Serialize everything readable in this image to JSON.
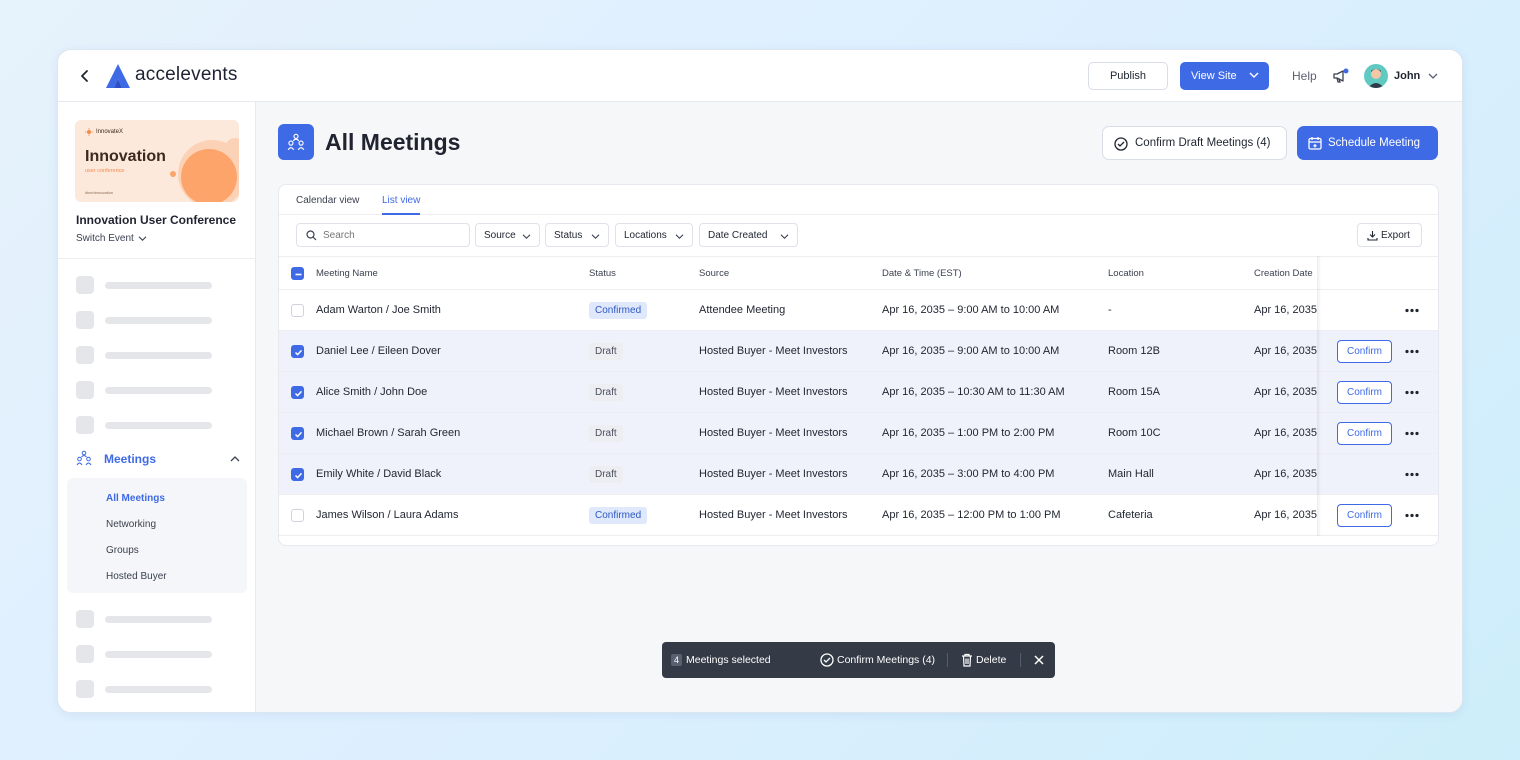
{
  "app": {
    "logo_text": "accelevents"
  },
  "header": {
    "publish_label": "Publish",
    "view_site_label": "View Site",
    "help_label": "Help",
    "user_name": "John"
  },
  "sidebar": {
    "banner": {
      "brand": "InnovateX",
      "title": "Innovation",
      "subtitle": "user conference",
      "tag": "#techinnovation"
    },
    "event_name": "Innovation User Conference",
    "switch_event_label": "Switch Event",
    "meetings_label": "Meetings",
    "submenu": [
      "All Meetings",
      "Networking",
      "Groups",
      "Hosted Buyer"
    ]
  },
  "page": {
    "title": "All Meetings",
    "confirm_drafts_label": "Confirm Draft Meetings (4)",
    "schedule_label": "Schedule Meeting"
  },
  "tabs": [
    "Calendar view",
    "List view"
  ],
  "toolbar": {
    "search_placeholder": "Search",
    "filters": [
      "Source",
      "Status",
      "Locations",
      "Date Created"
    ],
    "export_label": "Export"
  },
  "table": {
    "columns": [
      "Meeting Name",
      "Status",
      "Source",
      "Date & Time (EST)",
      "Location",
      "Creation Date"
    ],
    "rows": [
      {
        "name": "Adam Warton / Joe Smith",
        "status": "Confirmed",
        "source": "Attendee Meeting",
        "datetime": "Apr 16, 2035  – 9:00 AM to 10:00 AM",
        "location": "-",
        "created": "Apr 16, 2035",
        "checked": false,
        "confirm": false
      },
      {
        "name": "Daniel Lee / Eileen Dover",
        "status": "Draft",
        "source": "Hosted Buyer - Meet Investors",
        "datetime": "Apr 16, 2035  – 9:00 AM to 10:00 AM",
        "location": "Room 12B",
        "created": "Apr 16, 2035",
        "checked": true,
        "confirm": true
      },
      {
        "name": "Alice Smith / John Doe",
        "status": "Draft",
        "source": "Hosted Buyer - Meet Investors",
        "datetime": "Apr 16, 2035  – 10:30 AM to 11:30 AM",
        "location": "Room 15A",
        "created": "Apr 16, 2035",
        "checked": true,
        "confirm": true
      },
      {
        "name": "Michael Brown / Sarah Green",
        "status": "Draft",
        "source": "Hosted Buyer - Meet Investors",
        "datetime": "Apr 16, 2035  – 1:00 PM to 2:00 PM",
        "location": "Room 10C",
        "created": "Apr 16, 2035",
        "checked": true,
        "confirm": true
      },
      {
        "name": "Emily White / David Black",
        "status": "Draft",
        "source": "Hosted Buyer - Meet Investors",
        "datetime": "Apr 16, 2035  – 3:00 PM to 4:00 PM",
        "location": "Main Hall",
        "created": "Apr 16, 2035",
        "checked": true,
        "confirm": false
      },
      {
        "name": "James Wilson / Laura Adams",
        "status": "Confirmed",
        "source": "Hosted Buyer - Meet Investors",
        "datetime": "Apr 16, 2035  – 12:00 PM to 1:00 PM",
        "location": "Cafeteria",
        "created": "Apr 16, 2035",
        "checked": false,
        "confirm": true
      }
    ],
    "row_confirm_label": "Confirm"
  },
  "action_bar": {
    "count": "4",
    "selected_label": "Meetings selected",
    "confirm_label": "Confirm Meetings (4)",
    "delete_label": "Delete"
  },
  "colors": {
    "accent": "#3f6ae6",
    "action_bar": "#343a46"
  }
}
